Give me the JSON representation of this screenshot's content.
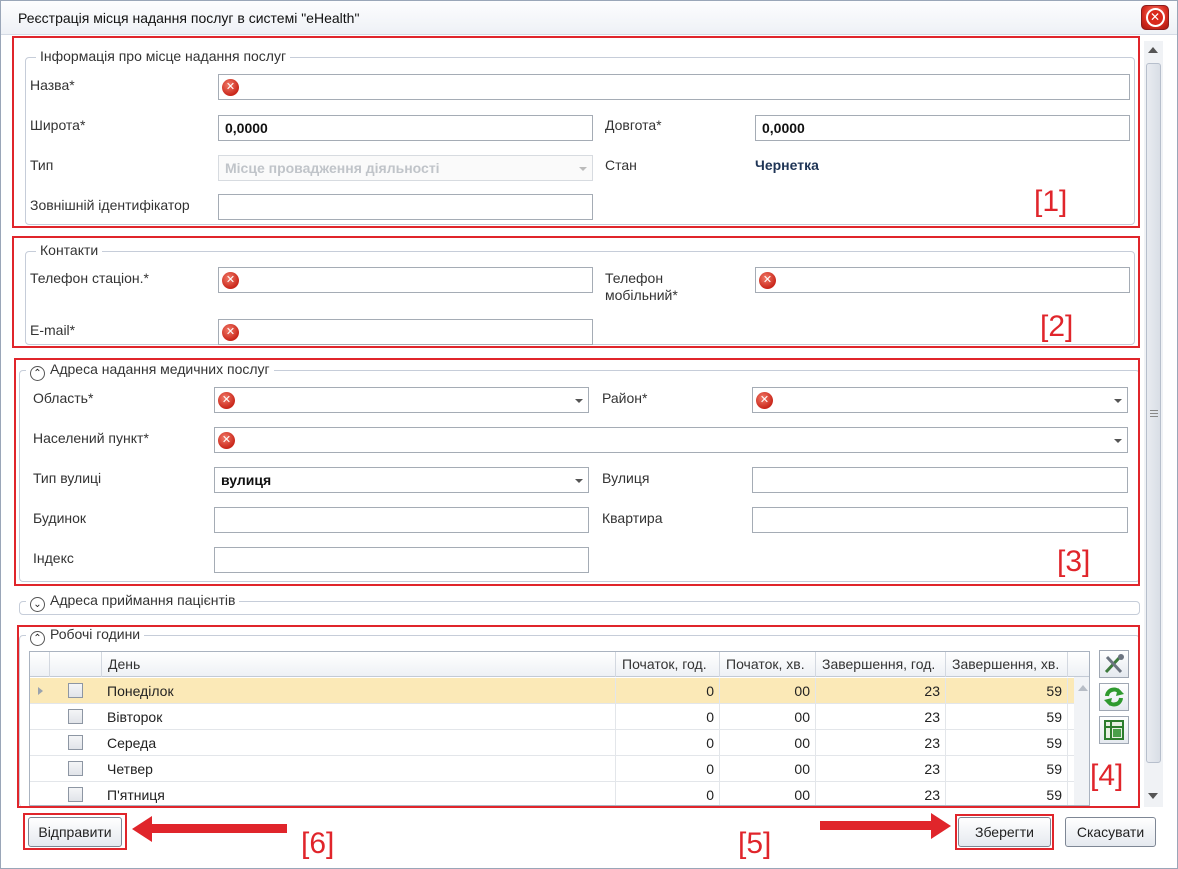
{
  "window": {
    "title": "Реєстрація місця надання послуг в системі \"eHealth\""
  },
  "section_info": {
    "legend": "Інформація про місце надання послуг",
    "name_label": "Назва*",
    "name_value": "",
    "lat_label": "Широта*",
    "lat_value": "0,0000",
    "lon_label": "Довгота*",
    "lon_value": "0,0000",
    "type_label": "Тип",
    "type_value": "Місце провадження діяльності",
    "state_label": "Стан",
    "state_value": "Чернетка",
    "ext_id_label": "Зовнішній ідентифікатор",
    "ext_id_value": ""
  },
  "section_contacts": {
    "legend": "Контакти",
    "phone_label": "Телефон стаціон.*",
    "mobile_label": "Телефон мобільний*",
    "email_label": "E-mail*"
  },
  "section_address": {
    "legend": "Адреса надання медичних послуг",
    "toggle": "⌃",
    "region_label": "Область*",
    "district_label": "Район*",
    "settlement_label": "Населений пункт*",
    "street_type_label": "Тип вулиці",
    "street_type_value": "вулиця",
    "street_label": "Вулиця",
    "house_label": "Будинок",
    "apartment_label": "Квартира",
    "index_label": "Індекс"
  },
  "section_patients": {
    "legend": "Адреса приймання пацієнтів",
    "toggle": "⌄"
  },
  "section_hours": {
    "legend": "Робочі години",
    "toggle": "⌃",
    "columns": [
      "День",
      "Початок, год.",
      "Початок, хв.",
      "Завершення, год.",
      "Завершення, хв."
    ],
    "rows": [
      {
        "day": "Понеділок",
        "sh": "0",
        "sm": "00",
        "eh": "23",
        "em": "59"
      },
      {
        "day": "Вівторок",
        "sh": "0",
        "sm": "00",
        "eh": "23",
        "em": "59"
      },
      {
        "day": "Середа",
        "sh": "0",
        "sm": "00",
        "eh": "23",
        "em": "59"
      },
      {
        "day": "Четвер",
        "sh": "0",
        "sm": "00",
        "eh": "23",
        "em": "59"
      },
      {
        "day": "П'ятниця",
        "sh": "0",
        "sm": "00",
        "eh": "23",
        "em": "59"
      }
    ]
  },
  "buttons": {
    "send": "Відправити",
    "save": "Зберегти",
    "cancel": "Скасувати"
  },
  "annotations": {
    "a1": "[1]",
    "a2": "[2]",
    "a3": "[3]",
    "a4": "[4]",
    "a5": "[5]",
    "a6": "[6]"
  },
  "icons": {
    "error": "error-icon",
    "close": "close-icon"
  },
  "colors": {
    "annotation_red": "#e0252b",
    "selected_row": "#fbe9b7",
    "state_text": "#1f3556"
  }
}
